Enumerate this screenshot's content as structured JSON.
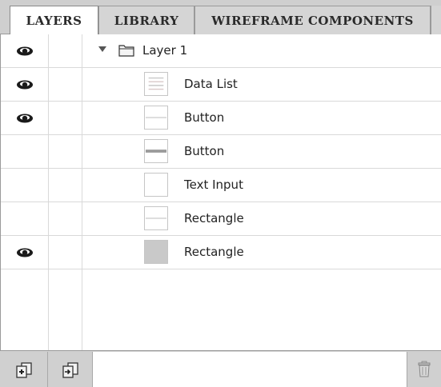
{
  "tabs": [
    {
      "label": "LAYERS",
      "active": true
    },
    {
      "label": "LIBRARY",
      "active": false
    },
    {
      "label": "WIREFRAME COMPONENTS",
      "active": false
    }
  ],
  "layers": [
    {
      "name": "Layer 1",
      "visible": true,
      "type": "folder",
      "icon": "folder-icon",
      "expanded": true
    },
    {
      "name": "Data List",
      "visible": true,
      "type": "item",
      "icon": "data-list-thumbnail"
    },
    {
      "name": "Button",
      "visible": true,
      "type": "item",
      "icon": "button-thumbnail"
    },
    {
      "name": "Button",
      "visible": false,
      "type": "item",
      "icon": "button-gray-thumbnail"
    },
    {
      "name": "Text Input",
      "visible": false,
      "type": "item",
      "icon": "text-input-thumbnail"
    },
    {
      "name": "Rectangle",
      "visible": false,
      "type": "item",
      "icon": "rectangle-thumbnail"
    },
    {
      "name": "Rectangle",
      "visible": true,
      "type": "item",
      "icon": "filled-rectangle-thumbnail"
    }
  ],
  "toolbar": {
    "new_layer_icon": "new-layer-icon",
    "move_layer_icon": "move-to-layer-icon",
    "delete_icon": "trash-icon"
  },
  "colors": {
    "tab_bar_bg": "#cfcfcf",
    "active_tab_bg": "#ffffff",
    "row_divider": "#d9d9d9",
    "text": "#222222"
  }
}
